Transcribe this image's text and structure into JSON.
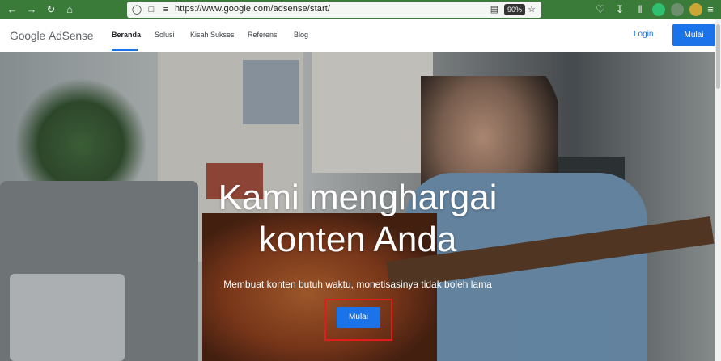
{
  "browser": {
    "url": "https://www.google.com/adsense/start/",
    "zoom": "90%",
    "icons": [
      "back-icon",
      "forward-icon",
      "reload-icon",
      "home-icon",
      "shield-icon",
      "lock-icon",
      "permissions-icon",
      "reader-icon",
      "bookmark-star-icon",
      "pocket-icon",
      "download-icon",
      "library-icon",
      "extension-icon",
      "extension-icon",
      "extension-icon",
      "menu-icon"
    ]
  },
  "header": {
    "logo_google": "Google",
    "logo_product": "AdSense",
    "nav": [
      "Beranda",
      "Solusi",
      "Kisah Sukses",
      "Referensi",
      "Blog"
    ],
    "login": "Login",
    "start": "Mulai"
  },
  "hero": {
    "title_line1": "Kami menghargai",
    "title_line2": "konten Anda",
    "subtitle": "Membuat konten butuh waktu, monetisasinya tidak boleh lama",
    "button": "Mulai",
    "highlight_color": "#e21b1b"
  },
  "colors": {
    "toolbar": "#3a7b3a",
    "accent": "#1a73e8"
  }
}
